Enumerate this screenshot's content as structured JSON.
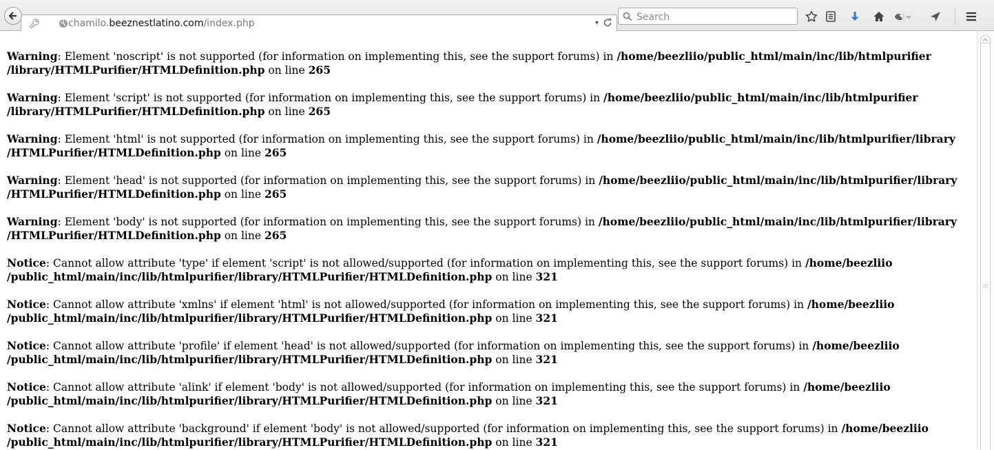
{
  "browser": {
    "url": {
      "prefix": "chamilo.",
      "host": "beeznestlatino.com",
      "path": "/index.php"
    },
    "search": {
      "placeholder": "Search"
    },
    "toolbar_icons": [
      "star-icon",
      "reading-list-icon",
      "download-icon",
      "home-icon",
      "extension-icon",
      "send-icon",
      "menu-icon"
    ],
    "accent_color": "#2a7fd4"
  },
  "messages": [
    {
      "level": "Warning",
      "text": ": Element 'noscript' is not supported (for information on implementing this, see the support forums) in ",
      "path": "/home/beezliio/public_html/main/inc/lib/htmlpurifier /library/HTMLPurifier/HTMLDefinition.php",
      "line_label": " on line ",
      "line": "265"
    },
    {
      "level": "Warning",
      "text": ": Element 'script' is not supported (for information on implementing this, see the support forums) in ",
      "path": "/home/beezliio/public_html/main/inc/lib/htmlpurifier /library/HTMLPurifier/HTMLDefinition.php",
      "line_label": " on line ",
      "line": "265"
    },
    {
      "level": "Warning",
      "text": ": Element 'html' is not supported (for information on implementing this, see the support forums) in ",
      "path": "/home/beezliio/public_html/main/inc/lib/htmlpurifier/library /HTMLPurifier/HTMLDefinition.php",
      "line_label": " on line ",
      "line": "265"
    },
    {
      "level": "Warning",
      "text": ": Element 'head' is not supported (for information on implementing this, see the support forums) in ",
      "path": "/home/beezliio/public_html/main/inc/lib/htmlpurifier/library /HTMLPurifier/HTMLDefinition.php",
      "line_label": " on line ",
      "line": "265"
    },
    {
      "level": "Warning",
      "text": ": Element 'body' is not supported (for information on implementing this, see the support forums) in ",
      "path": "/home/beezliio/public_html/main/inc/lib/htmlpurifier/library /HTMLPurifier/HTMLDefinition.php",
      "line_label": " on line ",
      "line": "265"
    },
    {
      "level": "Notice",
      "text": ": Cannot allow attribute 'type' if element 'script' is not allowed/supported (for information on implementing this, see the support forums) in ",
      "path": "/home/beezliio /public_html/main/inc/lib/htmlpurifier/library/HTMLPurifier/HTMLDefinition.php",
      "line_label": " on line ",
      "line": "321"
    },
    {
      "level": "Notice",
      "text": ": Cannot allow attribute 'xmlns' if element 'html' is not allowed/supported (for information on implementing this, see the support forums) in ",
      "path": "/home/beezliio /public_html/main/inc/lib/htmlpurifier/library/HTMLPurifier/HTMLDefinition.php",
      "line_label": " on line ",
      "line": "321"
    },
    {
      "level": "Notice",
      "text": ": Cannot allow attribute 'profile' if element 'head' is not allowed/supported (for information on implementing this, see the support forums) in ",
      "path": "/home/beezliio /public_html/main/inc/lib/htmlpurifier/library/HTMLPurifier/HTMLDefinition.php",
      "line_label": " on line ",
      "line": "321"
    },
    {
      "level": "Notice",
      "text": ": Cannot allow attribute 'alink' if element 'body' is not allowed/supported (for information on implementing this, see the support forums) in ",
      "path": "/home/beezliio /public_html/main/inc/lib/htmlpurifier/library/HTMLPurifier/HTMLDefinition.php",
      "line_label": " on line ",
      "line": "321"
    },
    {
      "level": "Notice",
      "text": ": Cannot allow attribute 'background' if element 'body' is not allowed/supported (for information on implementing this, see the support forums) in ",
      "path": "/home/beezliio /public_html/main/inc/lib/htmlpurifier/library/HTMLPurifier/HTMLDefinition.php",
      "line_label": " on line ",
      "line": "321"
    }
  ]
}
